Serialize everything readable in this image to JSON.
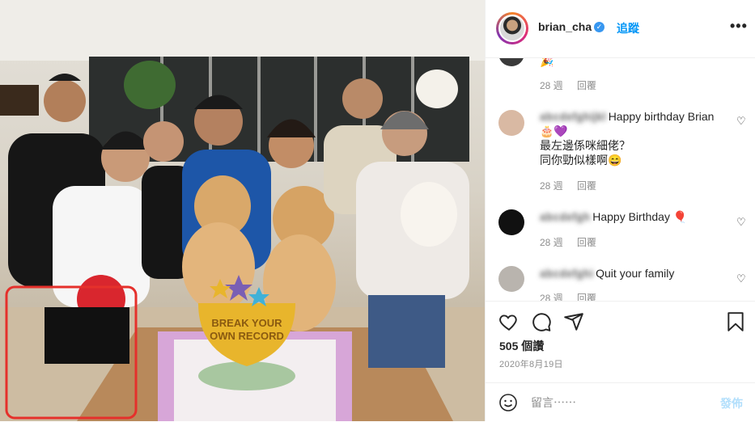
{
  "header": {
    "username": "brian_cha",
    "verified_glyph": "✓",
    "separator": "•",
    "follow_label": "追蹤",
    "more_glyph": "•••"
  },
  "comments": [
    {
      "avatar_color": "#3a3a3a",
      "text_top": "🎉",
      "age": "28 週",
      "reply": "回覆"
    },
    {
      "avatar_color": "#d9b9a3",
      "blurred_name": "abcdefghijkl",
      "text": "Happy birthday Brian",
      "line2": "🎂💜",
      "line3": "最左邊係咪細佬？",
      "line4": "同你勁似樣啊😄",
      "age": "28 週",
      "reply": "回覆"
    },
    {
      "avatar_color": "#111111",
      "blurred_name": "abcdefgh",
      "text": "Happy Birthday 🎈",
      "age": "28 週",
      "reply": "回覆"
    },
    {
      "avatar_color": "#b9b4ae",
      "blurred_name": "abcdefghi",
      "text": "Quit your family",
      "age": "28 週",
      "reply": "回覆"
    }
  ],
  "post": {
    "likes": "505 個讚",
    "date": "2020年8月19日"
  },
  "comment_box": {
    "placeholder": "留言⋯⋯",
    "post_label": "發佈"
  },
  "photo": {
    "cake_text_line1": "BREAK YOUR",
    "cake_text_line2": "OWN RECORD"
  }
}
